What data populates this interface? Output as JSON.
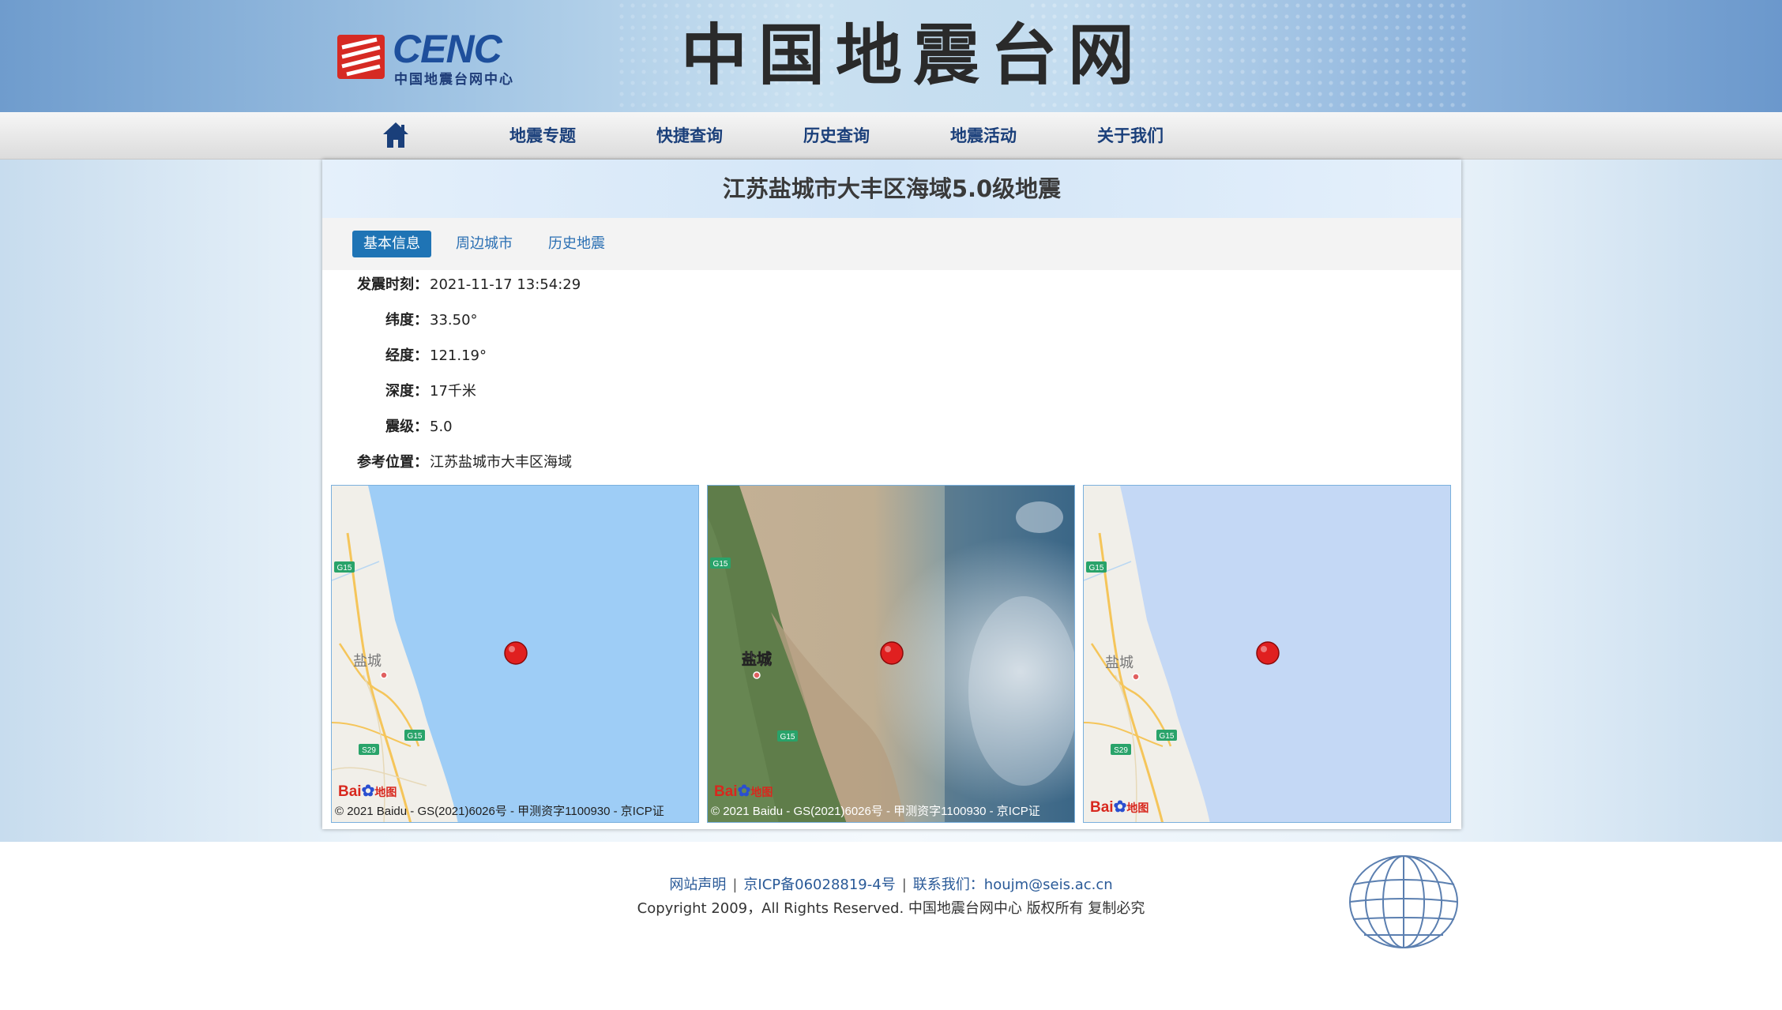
{
  "header": {
    "logo_text": "CENC",
    "logo_subtitle": "中国地震台网中心",
    "site_title": "中国地震台网"
  },
  "nav": {
    "home_icon": "home-icon",
    "items": [
      {
        "label": "地震专题"
      },
      {
        "label": "快捷查询"
      },
      {
        "label": "历史查询"
      },
      {
        "label": "地震活动"
      },
      {
        "label": "关于我们"
      }
    ]
  },
  "event": {
    "title": "江苏盐城市大丰区海域5.0级地震",
    "tabs": [
      {
        "label": "基本信息",
        "active": true
      },
      {
        "label": "周边城市",
        "active": false
      },
      {
        "label": "历史地震",
        "active": false
      }
    ],
    "info": [
      {
        "label": "发震时刻：",
        "value": "2021-11-17 13:54:29"
      },
      {
        "label": "纬度：",
        "value": "33.50°"
      },
      {
        "label": "经度：",
        "value": "121.19°"
      },
      {
        "label": "深度：",
        "value": "17千米"
      },
      {
        "label": "震级：",
        "value": "5.0"
      },
      {
        "label": "参考位置：",
        "value": "江苏盐城市大丰区海域"
      }
    ]
  },
  "maps": [
    {
      "type": "road",
      "city_label": "盐城",
      "road_labels": [
        "G15",
        "G15",
        "S29"
      ],
      "copyright": "© 2021 Baidu - GS(2021)6026号 - 甲测资字1100930 - 京ICP证"
    },
    {
      "type": "satellite",
      "city_label": "盐城",
      "road_labels": [
        "G15",
        "G15"
      ],
      "copyright": "© 2021 Baidu - GS(2021)6026号 - 甲测资字1100930 - 京ICP证"
    },
    {
      "type": "road",
      "city_label": "盐城",
      "road_labels": [
        "G15",
        "G15",
        "S29"
      ],
      "copyright": ""
    }
  ],
  "baidu_logo": {
    "text_bai": "Bai",
    "text_du": "du",
    "text_map": "地图"
  },
  "footer": {
    "links": [
      "网站声明",
      "京ICP备06028819-4号",
      "联系我们：houjm@seis.ac.cn"
    ],
    "copyright": "Copyright 2009，All Rights Reserved. 中国地震台网中心 版权所有 复制必究"
  },
  "colors": {
    "accent": "#1f74b5",
    "epicenter": "#e02020",
    "sea_road": "#9ecdf6",
    "sea_road_alt": "#c4d8f5",
    "land": "#f1efe9"
  }
}
